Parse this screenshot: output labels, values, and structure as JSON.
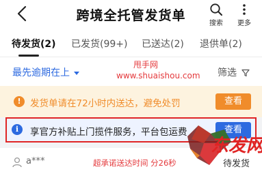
{
  "header": {
    "title": "跨境全托管发货单",
    "search_label": "搜索",
    "more_label": "更多"
  },
  "tabs": [
    {
      "label": "待发货(2)",
      "active": true
    },
    {
      "label": "已发货(99+)",
      "active": false
    },
    {
      "label": "已送达(2)",
      "active": false
    },
    {
      "label": "退供单(2)",
      "active": false
    }
  ],
  "sort": {
    "selected": "最先逾期在上",
    "filter_label": "筛选"
  },
  "watermark": {
    "line1": "甩手网",
    "line2": "www.shuaishou.com"
  },
  "notice_warning": {
    "text": "发货单请在72小时内送达，避免处罚",
    "button": "查看",
    "color": "#f08c2b"
  },
  "notice_info": {
    "text": "享官方补贴上门揽件服务，平台包运费",
    "button": "查看",
    "color": "#2d6ae0",
    "highlight_border": "#e02424"
  },
  "order": {
    "buyer": "a***",
    "promise": "超承诺送达时间 分26秒",
    "status": "待发货"
  },
  "logo_text": "东发网"
}
